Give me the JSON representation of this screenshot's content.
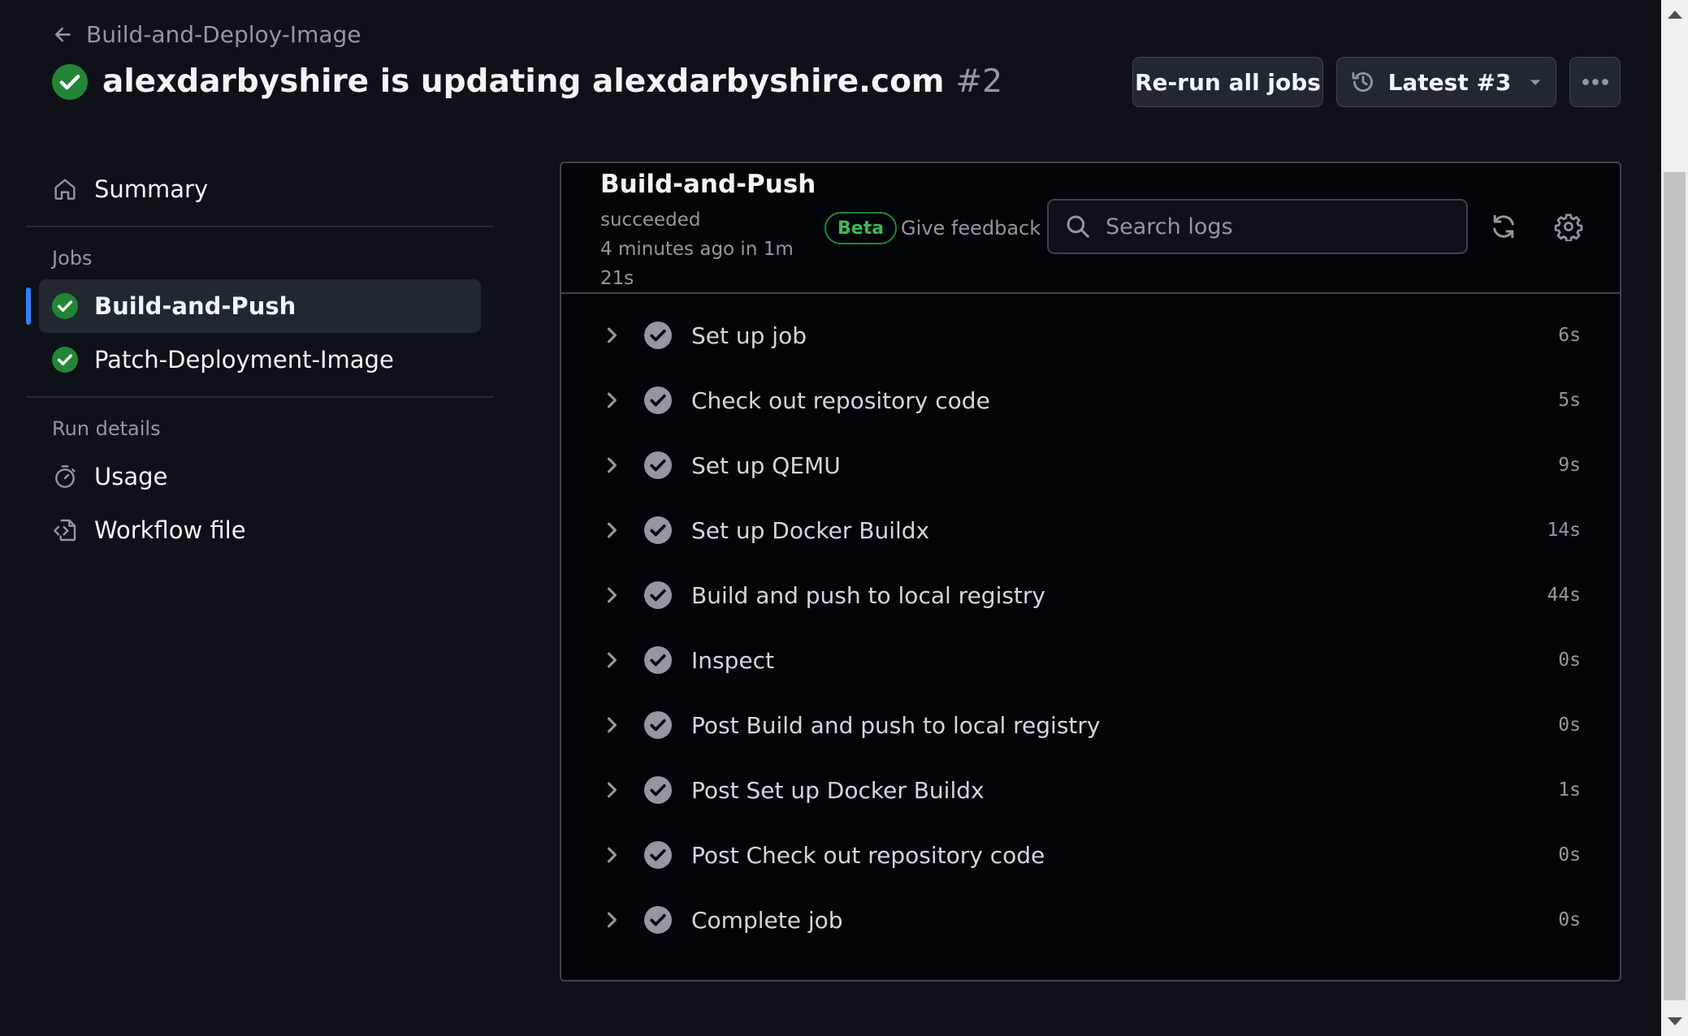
{
  "header": {
    "back_label": "Build-and-Deploy-Image",
    "title": "alexdarbyshire is updating alexdarbyshire.com",
    "run_number": "#2",
    "rerun_label": "Re-run all jobs",
    "attempt_label": "Latest #3"
  },
  "sidebar": {
    "summary_label": "Summary",
    "jobs_heading": "Jobs",
    "jobs": [
      {
        "label": "Build-and-Push"
      },
      {
        "label": "Patch-Deployment-Image"
      }
    ],
    "run_details_heading": "Run details",
    "usage_label": "Usage",
    "workflow_file_label": "Workflow file"
  },
  "job": {
    "name": "Build-and-Push",
    "status": "succeeded",
    "meta_line1": "4 minutes ago in 1m",
    "meta_line2": "21s",
    "beta_badge": "Beta",
    "feedback_label": "Give feedback",
    "search_placeholder": "Search logs"
  },
  "steps": [
    {
      "label": "Set up job",
      "duration": "6s"
    },
    {
      "label": "Check out repository code",
      "duration": "5s"
    },
    {
      "label": "Set up QEMU",
      "duration": "9s"
    },
    {
      "label": "Set up Docker Buildx",
      "duration": "14s"
    },
    {
      "label": "Build and push to local registry",
      "duration": "44s"
    },
    {
      "label": "Inspect",
      "duration": "0s"
    },
    {
      "label": "Post Build and push to local registry",
      "duration": "0s"
    },
    {
      "label": "Post Set up Docker Buildx",
      "duration": "1s"
    },
    {
      "label": "Post Check out repository code",
      "duration": "0s"
    },
    {
      "label": "Complete job",
      "duration": "0s"
    }
  ],
  "colors": {
    "background": "#0e1117",
    "panel": "#010409",
    "success": "#238636",
    "accent": "#2f81f7"
  }
}
